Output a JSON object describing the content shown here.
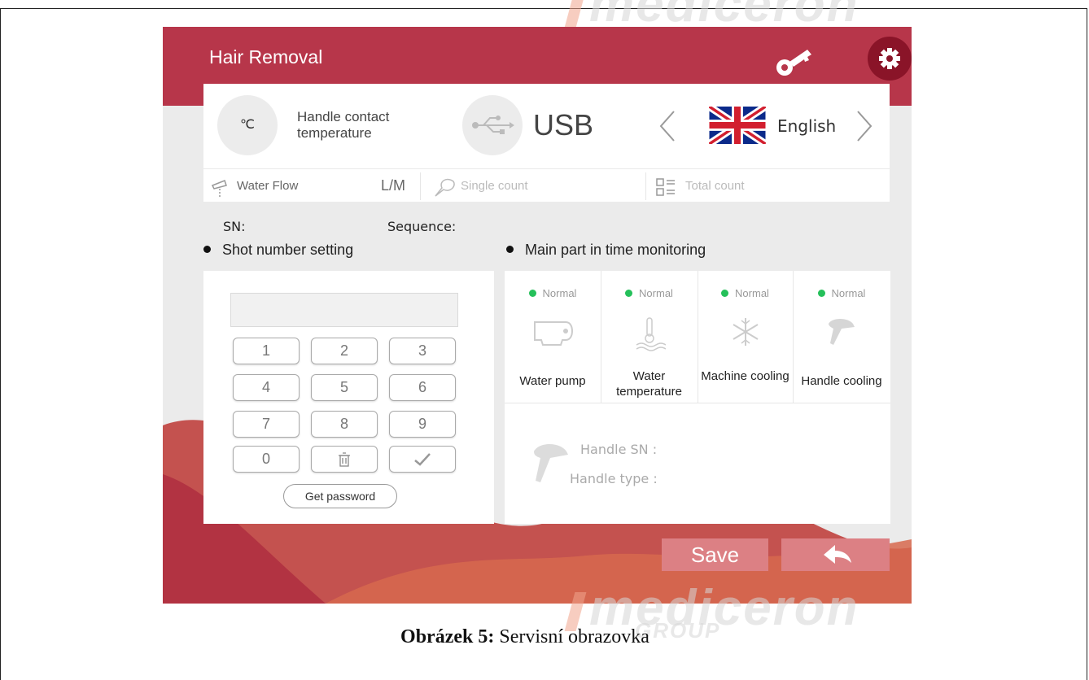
{
  "app": {
    "title": "Hair Removal"
  },
  "status": {
    "temperature_unit": "℃",
    "temperature_label": "Handle contact temperature",
    "connection": "USB",
    "language": "English"
  },
  "strip": {
    "water_flow_label": "Water Flow",
    "water_flow_unit": "L/M",
    "single_count_label": "Single count",
    "total_count_label": "Total count"
  },
  "info": {
    "sn_label": "SN:",
    "sequence_label": "Sequence:"
  },
  "shot_setting": {
    "title": "Shot number setting",
    "keys": [
      "1",
      "2",
      "3",
      "4",
      "5",
      "6",
      "7",
      "8",
      "9",
      "0"
    ],
    "get_password": "Get password"
  },
  "monitoring": {
    "title": "Main part in time monitoring",
    "items": [
      {
        "status": "Normal",
        "name": "Water pump",
        "icon": "pump-icon"
      },
      {
        "status": "Normal",
        "name": "Water temperature",
        "icon": "thermometer-water-icon"
      },
      {
        "status": "Normal",
        "name": "Machine cooling",
        "icon": "snowflake-icon"
      },
      {
        "status": "Normal",
        "name": "Handle cooling",
        "icon": "handpiece-icon"
      }
    ],
    "handle_sn_label": "Handle SN :",
    "handle_type_label": "Handle type :"
  },
  "actions": {
    "save": "Save",
    "back_icon": "back-arrow-icon"
  },
  "caption": {
    "bold": "Obrázek 5:",
    "text": " Servisní obrazovka"
  },
  "watermark": {
    "brand": "mediceron",
    "group": "GROUP"
  },
  "colors": {
    "header": "#b7364a",
    "button": "#dc8084",
    "status_ok": "#25c05a"
  }
}
